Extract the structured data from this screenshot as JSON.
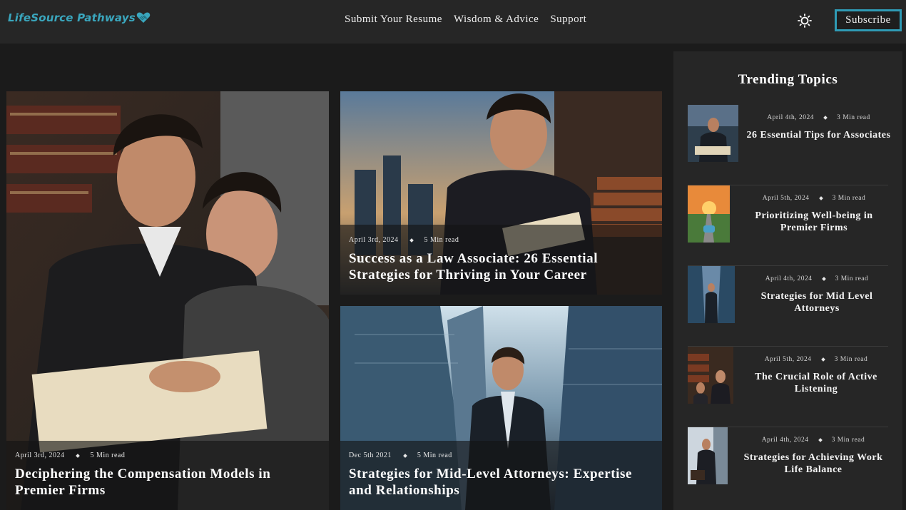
{
  "header": {
    "logo_text": "LifeSource Pathways",
    "nav": [
      "Submit Your Resume",
      "Wisdom & Advice",
      "Support"
    ],
    "theme_icon": "sun-icon",
    "subscribe_label": "Subscribe"
  },
  "featured": [
    {
      "date": "April 3rd, 2024",
      "read_time": "5 Min read",
      "title": "Deciphering the Compensation Models in Premier Firms"
    },
    {
      "date": "April 3rd, 2024",
      "read_time": "5 Min read",
      "title": "Success as a Law Associate: 26 Essential Strategies for Thriving in Your Career"
    },
    {
      "date": "Dec 5th 2021",
      "read_time": "5 Min read",
      "title": "Strategies for Mid-Level Attorneys: Expertise and Relationships"
    }
  ],
  "sidebar": {
    "title": "Trending Topics",
    "items": [
      {
        "date": "April 4th, 2024",
        "read_time": "3 Min read",
        "title": "26 Essential Tips for Associates"
      },
      {
        "date": "April 5th, 2024",
        "read_time": "3 Min read",
        "title": "Prioritizing Well-being in Premier Firms"
      },
      {
        "date": "April 4th, 2024",
        "read_time": "3 Min read",
        "title": "Strategies for Mid Level Attorneys"
      },
      {
        "date": "April 5th, 2024",
        "read_time": "3 Min read",
        "title": "The Crucial Role of Active Listening"
      },
      {
        "date": "April 4th, 2024",
        "read_time": "3 Min read",
        "title": "Strategies for Achieving Work Life Balance"
      }
    ]
  },
  "colors": {
    "accent": "#2f9bb5",
    "logo": "#3aa6bd",
    "background": "#1b1b1b",
    "panel": "#262626"
  }
}
